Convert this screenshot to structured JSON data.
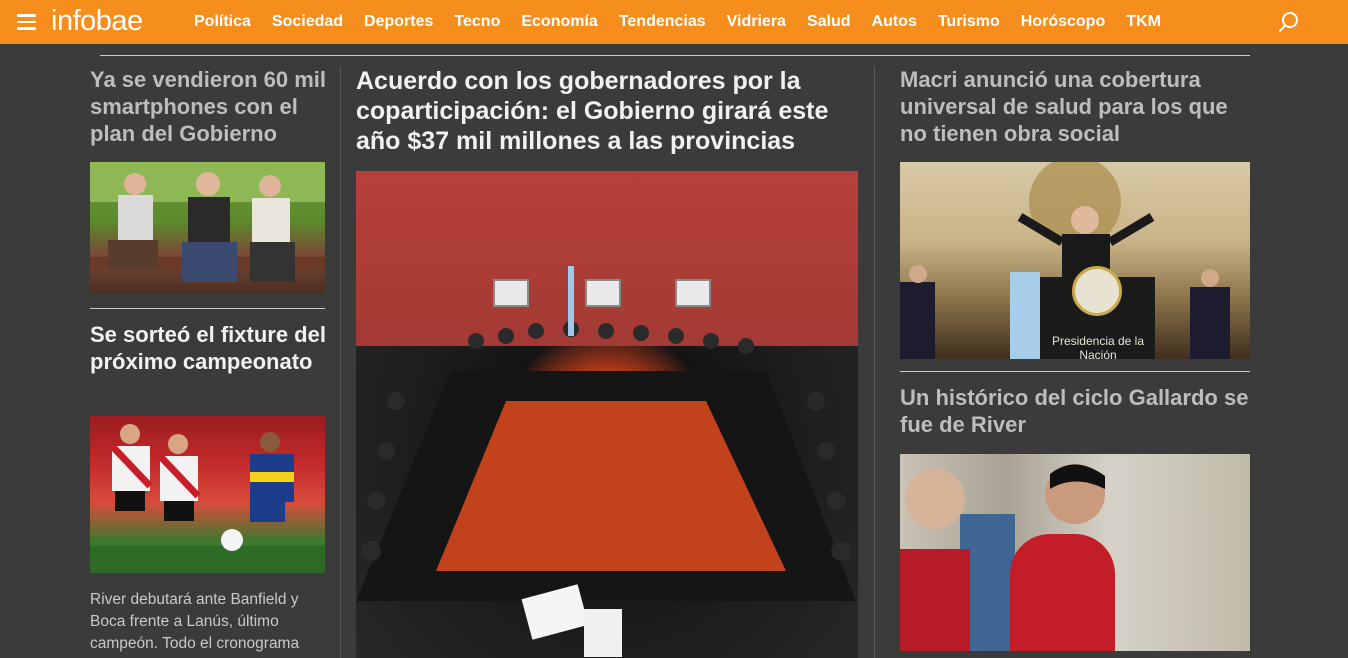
{
  "header": {
    "logo": "infobae",
    "nav": [
      "Política",
      "Sociedad",
      "Deportes",
      "Tecno",
      "Economía",
      "Tendencias",
      "Vidriera",
      "Salud",
      "Autos",
      "Turismo",
      "Horóscopo",
      "TKM"
    ]
  },
  "left_column": {
    "story1": {
      "headline": "Ya se vendieron 60 mil smartphones con el plan del Gobierno"
    },
    "story2": {
      "headline": "Se sorteó el fixture del próximo campeonato",
      "summary": "River debutará ante Banfield y Boca frente a Lanús, último campeón. Todo el cronograma"
    }
  },
  "center_column": {
    "main_story": {
      "headline": "Acuerdo con los gobernadores por la coparticipación: el Gobierno girará este año $37 mil millones a las provincias"
    }
  },
  "right_column": {
    "story1": {
      "headline": "Macri anunció una cobertura universal de salud para los que no tienen obra social",
      "podium_text": "Presidencia de la Nación"
    },
    "story2": {
      "headline": "Un histórico del ciclo Gallardo se fue de River"
    }
  },
  "colors": {
    "accent": "#f68e1e",
    "background": "#3b3b3b"
  }
}
